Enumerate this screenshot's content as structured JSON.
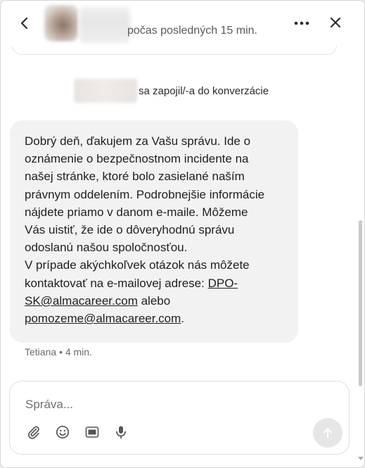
{
  "header": {
    "status_text": "počas posledných 15 min.",
    "back_icon": "chevron-left-icon",
    "more_icon": "more-horizontal-icon",
    "close_icon": "close-icon"
  },
  "conversation": {
    "join_notice": "sa zapojil/-a do konverzácie",
    "message": {
      "text": "Dobrý deň, ďakujem za Vašu správu. Ide o\noznámenie o bezpečnostnom incidente na\nnašej stránke, ktoré bolo zasielané naším\nprávnym oddelením. Podrobnejšie informácie\nnájdete priamo v danom e-maile. Môžeme\nVás uistiť, že ide o dôveryhodnú správu\nodoslanú našou spoločnosťou.\nV prípade akýchkoľvek otázok nás môžete\nkontaktovať na e-mailovej adrese: ",
      "link1_part1": "DPO-",
      "link1_part2": "SK@almacareer.com",
      "connector": " alebo",
      "link2": "pomozeme@almacareer.com",
      "end": ".",
      "sender": "Tetiana",
      "separator": "•",
      "time": "4 min."
    }
  },
  "composer": {
    "placeholder": "Správa...",
    "value": "",
    "tools": [
      "paperclip-icon",
      "emoji-icon",
      "gif-icon",
      "microphone-icon"
    ],
    "send_icon": "arrow-up-icon"
  },
  "colors": {
    "bubble_bg": "#f2f2f2",
    "window_bg": "#ffffff",
    "send_bg": "#e6e6e6"
  }
}
